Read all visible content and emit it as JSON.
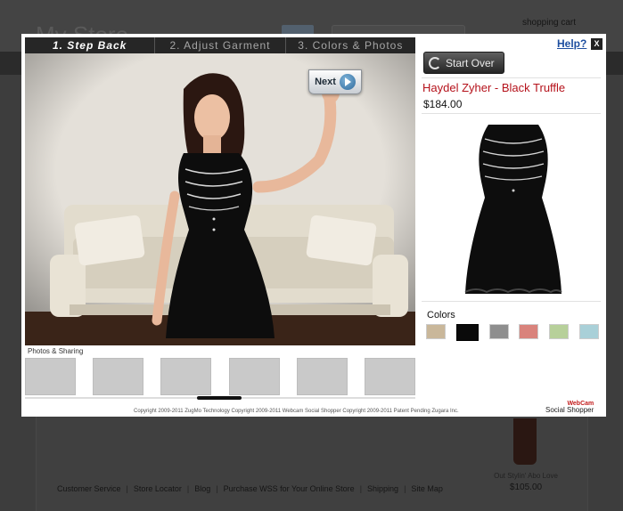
{
  "background_page": {
    "store_logo": "My Store",
    "cart_label": "shopping cart",
    "footer_links": [
      "Customer Service",
      "Store Locator",
      "Blog",
      "Purchase WSS for Your Online Store",
      "Shipping",
      "Site Map"
    ],
    "footer_separator": "|",
    "featured_product_name": "Out Stylin' Abo Love",
    "featured_product_price": "$105.00"
  },
  "modal": {
    "steps": [
      {
        "label": "1. Step Back",
        "active": true
      },
      {
        "label": "2. Adjust Garment",
        "active": false
      },
      {
        "label": "3. Colors & Photos",
        "active": false
      }
    ],
    "next_label": "Next",
    "help_label": "Help?",
    "close_label": "X",
    "start_over_label": "Start Over",
    "product": {
      "name": "Haydel Zyher - Black Truffle",
      "price": "$184.00",
      "garment_color": "#0d0d0d"
    },
    "colors_label": "Colors",
    "swatches": [
      {
        "name": "tan",
        "color": "#c9b79a",
        "selected": false
      },
      {
        "name": "black",
        "color": "#0a0a0a",
        "selected": true
      },
      {
        "name": "gray",
        "color": "#8e8e8e",
        "selected": false
      },
      {
        "name": "coral",
        "color": "#d9837c",
        "selected": false
      },
      {
        "name": "sage",
        "color": "#b7d09a",
        "selected": false
      },
      {
        "name": "sky",
        "color": "#a9d0d8",
        "selected": false
      }
    ],
    "photos_label": "Photos & Sharing",
    "photo_slot_count": 6,
    "copyright": "Copyright 2009-2011 ZugMo Technology Copyright 2009-2011 Webcam Social Shopper Copyright 2009-2011 Patent Pending Zugara Inc.",
    "brand": {
      "line1": "WebCam",
      "line2": "Social Shopper"
    }
  },
  "colors": {
    "accent_red": "#b5121b",
    "link_blue": "#1f4fa0",
    "tab_bar": "#262626"
  }
}
